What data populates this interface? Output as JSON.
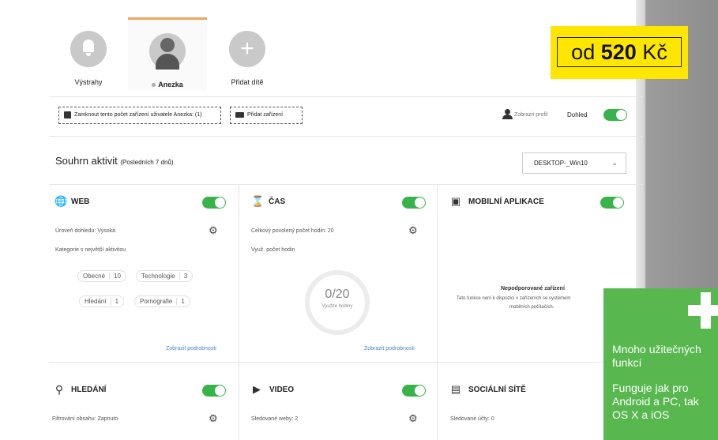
{
  "profiles": [
    {
      "label": "Výstrahy",
      "icon": "bell-icon"
    },
    {
      "label": "Anezka",
      "icon": "avatar-icon",
      "active": true
    },
    {
      "label": "Přidat dítě",
      "icon": "plus-icon"
    }
  ],
  "price_badge": {
    "prefix": "od",
    "amount": "520",
    "currency": "Kč"
  },
  "toolbar": {
    "lock_label": "Zamknout tento počet zařízení uživatele Anezka: (1)",
    "add_device_label": "Přidat zařízení",
    "view_profile_label": "Zobrazit profil",
    "supervision_label": "Dohled"
  },
  "summary": {
    "title": "Souhrn aktivit",
    "period": "(Posledních 7 dnů)",
    "device": "DESKTOP-_Win10"
  },
  "web": {
    "title": "WEB",
    "level": "Úroveň dohledu: Vysoká",
    "categories_label": "Kategorie s největší aktivitou",
    "chips": [
      {
        "name": "Obecné",
        "count": "10"
      },
      {
        "name": "Technologie",
        "count": "3"
      },
      {
        "name": "Hledání",
        "count": "1"
      },
      {
        "name": "Pornografie",
        "count": "1"
      }
    ],
    "link": "Zobrazit podrobnosti"
  },
  "time": {
    "title": "ČAS",
    "allowed": "Celkový povolený počet hodin: 20",
    "used_label": "Využ. počet hodin",
    "donut_value": "0/20",
    "donut_label": "Využité hodiny",
    "link": "Zobrazit podrobnosti"
  },
  "mobile": {
    "title": "MOBILNÍ APLIKACE",
    "unsupported_title": "Nepodporované zařízení",
    "unsupported_text": "Tato funkce není k dispozici v zařízeních se systémem",
    "unsupported_text2": "mobilních počítačích."
  },
  "search": {
    "title": "HLEDÁNÍ",
    "filter": "Filtrování obsahu: Zapnuto"
  },
  "video": {
    "title": "VIDEO",
    "sites": "Sledované weby: 2"
  },
  "social": {
    "title": "SOCIÁLNÍ SÍTĚ",
    "accounts": "Sledované účty: 0"
  },
  "promo": {
    "line1": "Mnoho užitečných",
    "line2": "funkcí",
    "line3": "Funguje jak pro",
    "line4": "Android a PC, tak",
    "line5": "OS X a iOS"
  },
  "colors": {
    "toggle": "#37b34a",
    "badge": "#ffe600",
    "promo": "#58b84f",
    "tab_accent": "#f0a45c"
  }
}
